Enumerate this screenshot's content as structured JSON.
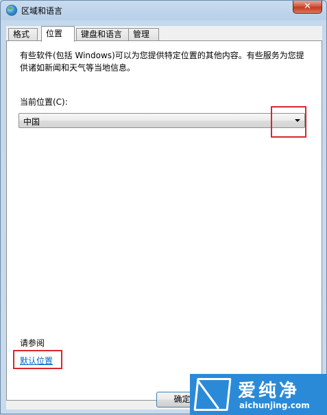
{
  "window": {
    "title": "区域和语言",
    "close_label": "✕"
  },
  "tabs": [
    {
      "label": "格式",
      "active": false
    },
    {
      "label": "位置",
      "active": true
    },
    {
      "label": "键盘和语言",
      "active": false
    },
    {
      "label": "管理",
      "active": false
    }
  ],
  "location": {
    "description": "有些软件(包括 Windows)可以为您提供特定位置的其他内容。有些服务为您提供诸如新闻和天气等当地信息。",
    "current_label": "当前位置(C):",
    "current_value": "中国"
  },
  "see_also": {
    "heading": "请参阅",
    "link": "默认位置"
  },
  "buttons": {
    "ok": "确定"
  },
  "watermark": {
    "title": "爱纯净",
    "url": "aichunjing.com"
  },
  "colors": {
    "highlight_box": "#d9252a",
    "link": "#0066cc",
    "watermark_bg": "#2a8ad8"
  }
}
